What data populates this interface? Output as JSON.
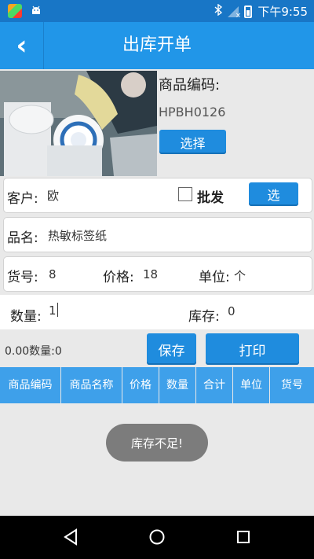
{
  "status_bar": {
    "time": "下午9:55",
    "bluetooth_icon": "bluetooth-icon",
    "signal_icon": "signal-no-sim-icon",
    "battery_icon": "battery-charging-icon"
  },
  "header": {
    "title": "出库开单",
    "back_icon": "chevron-left-icon",
    "back_glyph": "‹"
  },
  "product": {
    "code_label": "商品编码:",
    "code_value": "HPBH0126",
    "select_label": "选择"
  },
  "customer": {
    "label": "客户:",
    "value": "欧",
    "wholesale_label": "批发",
    "wholesale_checked": false,
    "pick_label": "选"
  },
  "item_name": {
    "label": "品名:",
    "value": "热敏标签纸"
  },
  "details": {
    "sku_label": "货号:",
    "sku_value": "8",
    "price_label": "价格:",
    "price_value": "18",
    "unit_label": "单位:",
    "unit_value": "个"
  },
  "quantity": {
    "qty_label": "数量:",
    "qty_value": "1",
    "stock_label": "库存:",
    "stock_value": "0"
  },
  "actions": {
    "summary": "0.00数量:0",
    "save_label": "保存",
    "print_label": "打印"
  },
  "table": {
    "columns": [
      "商品编码",
      "商品名称",
      "价格",
      "数量",
      "合计",
      "单位",
      "货号"
    ]
  },
  "toast": {
    "message": "库存不足!"
  },
  "colors": {
    "primary": "#2196e8",
    "status_bar": "#1876c6",
    "button": "#1f8cde",
    "table_header": "#3ea0ea",
    "toast": "#7c7c7c"
  }
}
